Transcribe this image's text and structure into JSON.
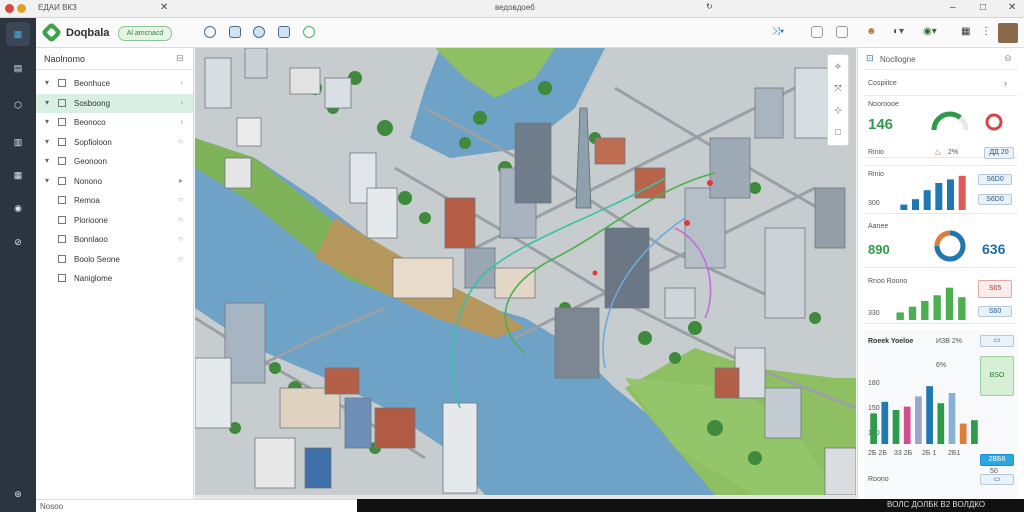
{
  "window": {
    "left_text": "ЕДАИ ВКЗ",
    "center_text": "ведовдоеб"
  },
  "header": {
    "app_name": "Doqbala",
    "pill_label": "Al amcnacd"
  },
  "layers_panel": {
    "title": "Naolnomo",
    "items": [
      {
        "label": "Beonhuce",
        "expander": "▾",
        "tail": "›"
      },
      {
        "label": "Sosboong",
        "expander": "▾",
        "tail": "›"
      },
      {
        "label": "Beonoco",
        "expander": "▾",
        "tail": "›"
      },
      {
        "label": "Sopfioloon",
        "expander": "▾",
        "tail": "○"
      },
      {
        "label": "Geonoon",
        "expander": "▾",
        "tail": ""
      },
      {
        "label": "Nonono",
        "expander": "▾",
        "tail": "▸"
      },
      {
        "label": "Remoa",
        "expander": "",
        "tail": "○"
      },
      {
        "label": "Plorioone",
        "expander": "",
        "tail": "○"
      },
      {
        "label": "Bonnlaoo",
        "expander": "",
        "tail": "○"
      },
      {
        "label": "Boolo Seone",
        "expander": "",
        "tail": "○"
      },
      {
        "label": "Naniglome",
        "expander": "",
        "tail": ""
      }
    ]
  },
  "bottom": {
    "left_text": "Nosoo"
  },
  "status_bar": {
    "text": "ВОЛС ДОЛБК В2 ВОЛДКО"
  },
  "right_panel": {
    "title": "Nocllogne",
    "section1": {
      "title": "Cospiitce",
      "subtitle": "Nooroooe",
      "value": "146",
      "gauge_pct": 0.72
    },
    "section2": {
      "label": "Rinio",
      "value": "2%",
      "badge": "Д̄Д 20"
    },
    "section3": {
      "label": "Rinio",
      "value": "300",
      "badge1": "S6D0",
      "badge2": "S6D0",
      "bars": [
        0.15,
        0.3,
        0.55,
        0.75,
        0.85,
        0.95
      ]
    },
    "section4": {
      "label": "Aanee",
      "value": "890",
      "value2": "636"
    },
    "section5": {
      "label": "Rnoo Roono",
      "value": "330",
      "badge1": "S65",
      "badge2": "S60",
      "bars": [
        0.2,
        0.35,
        0.5,
        0.65,
        0.85,
        0.6
      ]
    },
    "section6": {
      "title": "Roeek Yoeloe",
      "header_right": "ИЗВ 2%",
      "values": [
        "6%",
        "180",
        "150",
        "100",
        "50"
      ],
      "badge": "BSO",
      "footer": [
        "2Б 2Б",
        "33 2Б",
        "2Б 1",
        "2Б1"
      ],
      "bars": [
        {
          "val": 0.45,
          "color": "#2e9b4b"
        },
        {
          "val": 0.62,
          "color": "#1f77b4"
        },
        {
          "val": 0.5,
          "color": "#2e9b4b"
        },
        {
          "val": 0.55,
          "color": "#d04f8f"
        },
        {
          "val": 0.7,
          "color": "#9aa6c7"
        },
        {
          "val": 0.85,
          "color": "#1f77b4"
        },
        {
          "val": 0.6,
          "color": "#2e9b4b"
        },
        {
          "val": 0.75,
          "color": "#8ab0da"
        },
        {
          "val": 0.3,
          "color": "#e07b39"
        },
        {
          "val": 0.35,
          "color": "#2e9b4b"
        }
      ],
      "footer_badge": "2ВБ6",
      "footer_line": "Roono"
    }
  },
  "colors": {
    "accent": "#2e9b4b",
    "blue": "#1f77b4",
    "rail": "#2c3440"
  }
}
